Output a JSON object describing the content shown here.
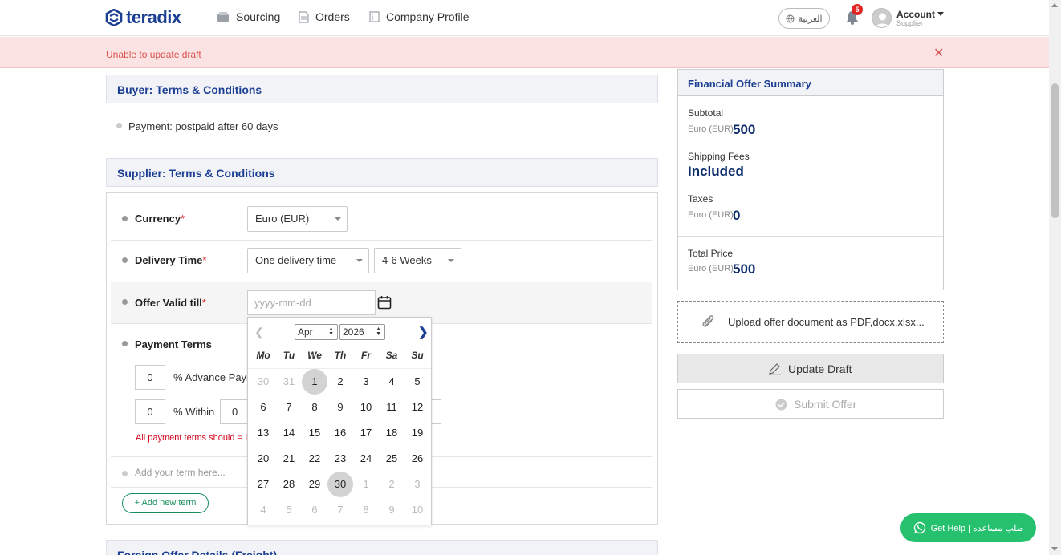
{
  "header": {
    "brand": "teradix",
    "nav": [
      {
        "label": "Sourcing",
        "icon": "sourcing-icon"
      },
      {
        "label": "Orders",
        "icon": "document-icon"
      },
      {
        "label": "Company Profile",
        "icon": "building-icon"
      }
    ],
    "language": "العربية",
    "notification_count": "5",
    "account_label": "Account",
    "account_role": "Supplier"
  },
  "alert": {
    "message": "Unable to update draft"
  },
  "buyer_terms": {
    "title": "Buyer: Terms & Conditions",
    "items": [
      "Payment: postpaid after 60 days"
    ]
  },
  "supplier_terms": {
    "title": "Supplier: Terms & Conditions",
    "currency_label": "Currency",
    "currency_value": "Euro (EUR)",
    "delivery_label": "Delivery Time",
    "delivery_type": "One delivery time",
    "delivery_value": "4-6 Weeks",
    "valid_label": "Offer Valid till",
    "valid_placeholder": "yyyy-mm-dd",
    "payment_label": "Payment Terms",
    "advance_value": "0",
    "advance_text": "% Advance Paym",
    "within_value": "0",
    "within_text": "% Within",
    "within_days": "0",
    "error": "All payment terms should = 1",
    "add_term_placeholder": "Add your term here...",
    "add_term_button": "+ Add new term",
    "required_mark": "*"
  },
  "next_section": {
    "title": "Foreign Offer Details (Freight)"
  },
  "datepicker": {
    "month": "Apr",
    "year": "2026",
    "weekdays": [
      "Mo",
      "Tu",
      "We",
      "Th",
      "Fr",
      "Sa",
      "Su"
    ],
    "weeks": [
      [
        "30",
        "31",
        "1",
        "2",
        "3",
        "4",
        "5"
      ],
      [
        "6",
        "7",
        "8",
        "9",
        "10",
        "11",
        "12"
      ],
      [
        "13",
        "14",
        "15",
        "16",
        "17",
        "18",
        "19"
      ],
      [
        "20",
        "21",
        "22",
        "23",
        "24",
        "25",
        "26"
      ],
      [
        "27",
        "28",
        "29",
        "30",
        "1",
        "2",
        "3"
      ],
      [
        "4",
        "5",
        "6",
        "7",
        "8",
        "9",
        "10"
      ]
    ]
  },
  "summary": {
    "title": "Financial Offer Summary",
    "subtotal_label": "Subtotal",
    "subtotal_currency": "Euro (EUR)",
    "subtotal_value": "500",
    "shipping_label": "Shipping Fees",
    "shipping_value": "Included",
    "taxes_label": "Taxes",
    "taxes_currency": "Euro (EUR)",
    "taxes_value": "0",
    "total_label": "Total Price",
    "total_currency": "Euro (EUR)",
    "total_value": "500"
  },
  "upload": {
    "label": "Upload offer document as PDF,docx,xlsx..."
  },
  "actions": {
    "update": "Update Draft",
    "submit": "Submit Offer"
  },
  "help": {
    "label": "Get Help | طلب مساعده"
  },
  "colors": {
    "brand": "#1c3f94",
    "alert_bg": "#fbe3e4",
    "error": "#d9534f",
    "help_green": "#25c16f"
  }
}
